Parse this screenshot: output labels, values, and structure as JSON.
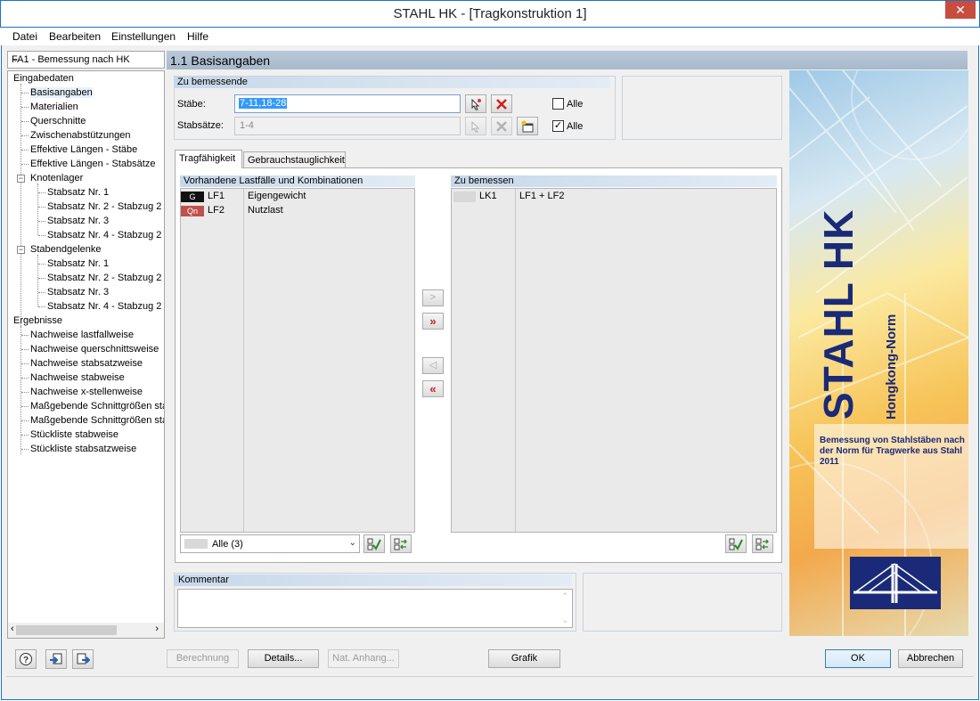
{
  "window": {
    "title": "STAHL HK - [Tragkonstruktion 1]",
    "close_glyph": "✕"
  },
  "menu": [
    "Datei",
    "Bearbeiten",
    "Einstellungen",
    "Hilfe"
  ],
  "module_combo": {
    "value": "FA1 - Bemessung nach HK"
  },
  "tree": {
    "input_root": "Eingabedaten",
    "input_items": [
      "Basisangaben",
      "Materialien",
      "Querschnitte",
      "Zwischenabstützungen",
      "Effektive Längen - Stäbe",
      "Effektive Längen - Stabsätze"
    ],
    "knotenlager": "Knotenlager",
    "knotenlager_items": [
      "Stabsatz Nr. 1",
      "Stabsatz Nr. 2 - Stabzug 2",
      "Stabsatz Nr. 3",
      "Stabsatz Nr. 4 - Stabzug 2"
    ],
    "stabendgelenke": "Stabendgelenke",
    "stabendgelenke_items": [
      "Stabsatz Nr. 1",
      "Stabsatz Nr. 2 - Stabzug 2",
      "Stabsatz Nr. 3",
      "Stabsatz Nr. 4 - Stabzug 2"
    ],
    "results_root": "Ergebnisse",
    "results_items": [
      "Nachweise lastfallweise",
      "Nachweise querschnittsweise",
      "Nachweise stabsatzweise",
      "Nachweise stabweise",
      "Nachweise x-stellenweise",
      "Maßgebende Schnittgrößen sta",
      "Maßgebende Schnittgrößen sta",
      "Stückliste stabweise",
      "Stückliste stabsatzweise"
    ],
    "collapse_glyph": "−"
  },
  "section": {
    "title": "1.1 Basisangaben"
  },
  "zu_bemessende": {
    "title": "Zu bemessende",
    "staebe_label": "Stäbe:",
    "staebe_value": "7-11,18-28",
    "stabsaetze_label": "Stabsätze:",
    "stabsaetze_value": "1-4",
    "alle_label": "Alle",
    "staebe_alle_checked": false,
    "stabsaetze_alle_checked": true,
    "check_glyph": "✓"
  },
  "tabs": [
    "Tragfähigkeit",
    "Gebrauchstauglichkeit"
  ],
  "available_loads": {
    "title": "Vorhandene Lastfälle und Kombinationen",
    "rows": [
      {
        "badge": "G",
        "badge_color": "#111111",
        "id": "LF1",
        "desc": "Eigengewicht"
      },
      {
        "badge": "Qn",
        "badge_color": "#c0504d",
        "id": "LF2",
        "desc": "Nutzlast"
      }
    ],
    "filter_value": "Alle (3)"
  },
  "selected_loads": {
    "title": "Zu bemessen",
    "rows": [
      {
        "id": "LK1",
        "desc": "LF1 + LF2"
      }
    ]
  },
  "transfer_buttons": {
    "add_one": ">",
    "add_all": "»",
    "remove_one": "◁",
    "remove_all": "«"
  },
  "comment": {
    "title": "Kommentar"
  },
  "side_image": {
    "brand": "STAHL HK",
    "subtitle": "Hongkong-Norm",
    "description": "Bemessung von Stahlstäben nach der Norm für Tragwerke aus Stahl 2011"
  },
  "bottom_buttons": {
    "berechnung": "Berechnung",
    "details": "Details...",
    "nat_anhang": "Nat. Anhang...",
    "grafik": "Grafik",
    "ok": "OK",
    "abbrechen": "Abbrechen"
  },
  "colors": {
    "accent": "#1b73c6",
    "header_band": "#b0c2d4",
    "close": "#c74d3f"
  }
}
